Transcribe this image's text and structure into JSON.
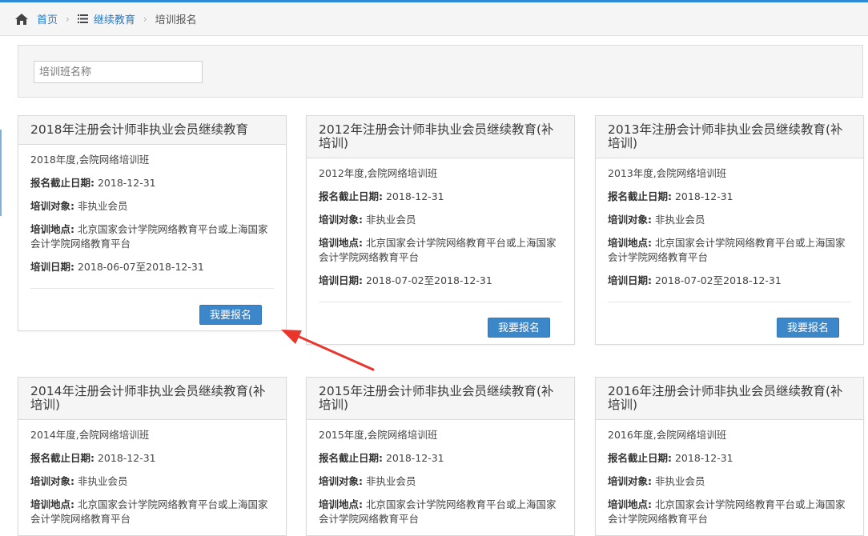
{
  "breadcrumb": {
    "home": "首页",
    "section": "继续教育",
    "current": "培训报名"
  },
  "search": {
    "placeholder": "培训班名称"
  },
  "labels": {
    "deadline": "报名截止日期:",
    "target": "培训对象:",
    "location": "培训地点:",
    "dates": "培训日期:"
  },
  "enroll_label": "我要报名",
  "courses": [
    {
      "title": "2018年注册会计师非执业会员继续教育",
      "subtitle": "2018年度,会院网络培训班",
      "deadline": "2018-12-31",
      "target": "非执业会员",
      "location": "北京国家会计学院网络教育平台或上海国家会计学院网络教育平台",
      "dates": "2018-06-07至2018-12-31"
    },
    {
      "title": "2012年注册会计师非执业会员继续教育(补培训)",
      "subtitle": "2012年度,会院网络培训班",
      "deadline": "2018-12-31",
      "target": "非执业会员",
      "location": "北京国家会计学院网络教育平台或上海国家会计学院网络教育平台",
      "dates": "2018-07-02至2018-12-31"
    },
    {
      "title": "2013年注册会计师非执业会员继续教育(补培训)",
      "subtitle": "2013年度,会院网络培训班",
      "deadline": "2018-12-31",
      "target": "非执业会员",
      "location": "北京国家会计学院网络教育平台或上海国家会计学院网络教育平台",
      "dates": "2018-07-02至2018-12-31"
    },
    {
      "title": "2014年注册会计师非执业会员继续教育(补培训)",
      "subtitle": "2014年度,会院网络培训班",
      "deadline": "2018-12-31",
      "target": "非执业会员",
      "location": "北京国家会计学院网络教育平台或上海国家会计学院网络教育平台"
    },
    {
      "title": "2015年注册会计师非执业会员继续教育(补培训)",
      "subtitle": "2015年度,会院网络培训班",
      "deadline": "2018-12-31",
      "target": "非执业会员",
      "location": "北京国家会计学院网络教育平台或上海国家会计学院网络教育平台"
    },
    {
      "title": "2016年注册会计师非执业会员继续教育(补培训)",
      "subtitle": "2016年度,会院网络培训班",
      "deadline": "2018-12-31",
      "target": "非执业会员",
      "location": "北京国家会计学院网络教育平台或上海国家会计学院网络教育平台"
    }
  ],
  "colors": {
    "accent": "#3c87c9",
    "link": "#2a7ac2",
    "annotation_arrow": "#e8362d"
  }
}
